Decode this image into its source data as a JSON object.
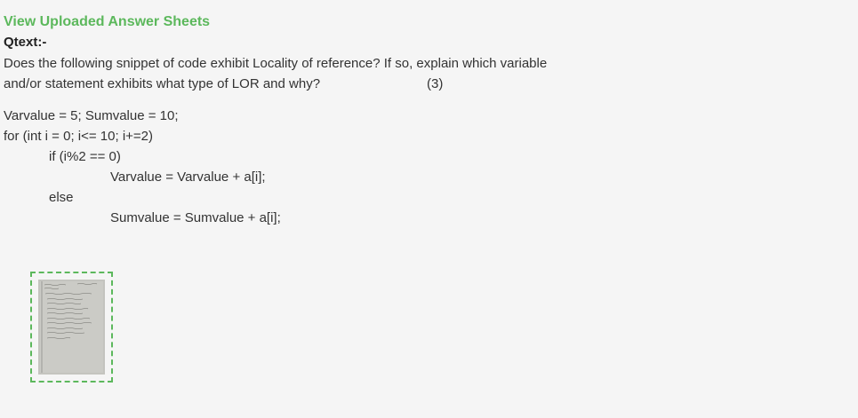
{
  "page": {
    "title": "View Uploaded Answer Sheets",
    "qtext_label": "Qtext:-"
  },
  "question": {
    "line1": "Does the following snippet of code exhibit Locality of reference? If so, explain which variable",
    "line2": "and/or statement exhibits what type of LOR and why?",
    "marks": "(3)"
  },
  "code": {
    "line1": "Varvalue = 5; Sumvalue = 10;",
    "line2": "for (int i = 0; i<= 10; i+=2)",
    "line3": "if  (i%2 == 0)",
    "line4": "Varvalue = Varvalue + a[i];",
    "line5": "else",
    "line6": "Sumvalue = Sumvalue + a[i];"
  },
  "answer_sheets": [
    {
      "icon": "handwritten-page-thumbnail"
    }
  ],
  "colors": {
    "accent": "#5cb85c",
    "background": "#f5f5f5",
    "text": "#333333"
  }
}
